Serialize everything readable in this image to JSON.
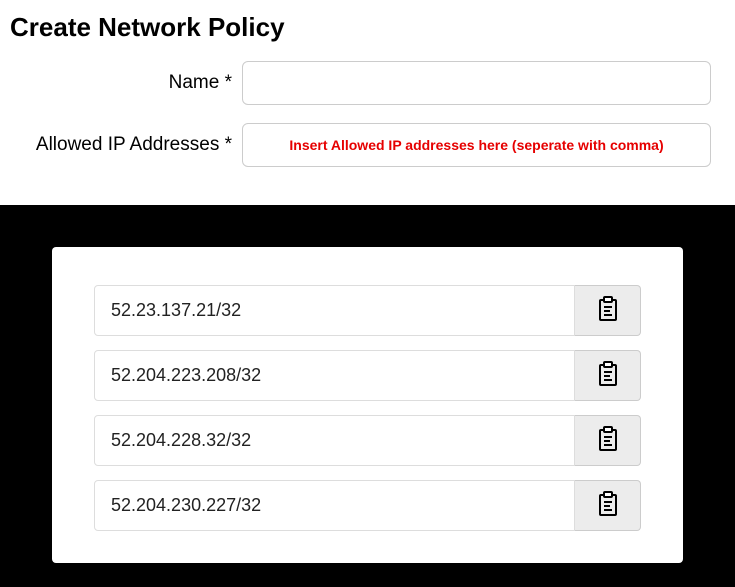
{
  "title": "Create Network Policy",
  "form": {
    "name": {
      "label": "Name *",
      "value": ""
    },
    "allowed_ips": {
      "label": "Allowed IP Addresses *",
      "placeholder": "Insert Allowed IP addresses here (seperate with comma)",
      "value": ""
    }
  },
  "ip_list": [
    {
      "address": "52.23.137.21/32"
    },
    {
      "address": "52.204.223.208/32"
    },
    {
      "address": "52.204.228.32/32"
    },
    {
      "address": "52.204.230.227/32"
    }
  ]
}
